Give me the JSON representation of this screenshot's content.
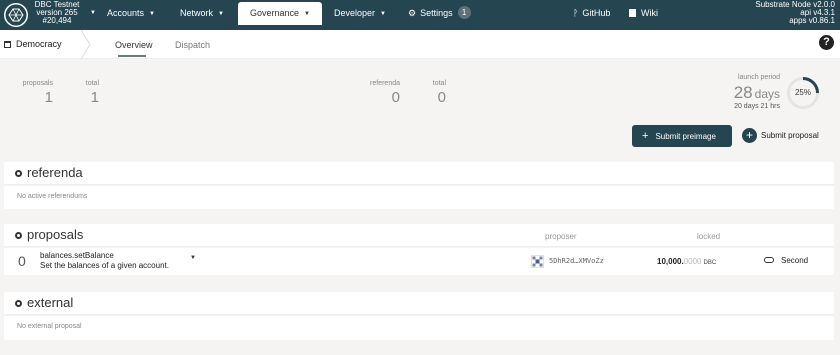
{
  "chain": {
    "name": "DBC Testnet",
    "version": "version 265",
    "block": "#20,494"
  },
  "nav": {
    "accounts": "Accounts",
    "network": "Network",
    "governance": "Governance",
    "developer": "Developer",
    "settings": "Settings",
    "settings_badge": "1",
    "github": "GitHub",
    "wiki": "Wiki"
  },
  "node": {
    "name": "Substrate Node v2.0.0",
    "api": "api v4.3.1",
    "apps": "apps v0.86.1"
  },
  "subnav": {
    "section": "Democracy",
    "tabs": [
      "Overview",
      "Dispatch"
    ]
  },
  "summary": {
    "proposals_label": "proposals",
    "proposals_value": "1",
    "proposals_total_label": "total",
    "proposals_total_value": "1",
    "referenda_label": "referenda",
    "referenda_value": "0",
    "referenda_total_label": "total",
    "referenda_total_value": "0",
    "launch_label": "launch period",
    "launch_days": "28",
    "launch_days_unit": "days",
    "launch_remaining": "20 days 21 hrs",
    "launch_percent": "25%",
    "launch_progress": 0.25
  },
  "actions": {
    "submit_preimage": "Submit preimage",
    "submit_proposal": "Submit proposal"
  },
  "referenda": {
    "title": "referenda",
    "empty": "No active referendums"
  },
  "proposals": {
    "title": "proposals",
    "col_proposer": "proposer",
    "col_locked": "locked",
    "rows": [
      {
        "index": "0",
        "call": "balances.setBalance",
        "description": "Set the balances of a given account.",
        "proposer": "5DhR2d…XMVoZz",
        "locked_int": "10,000.",
        "locked_dec": "0000",
        "unit": "DBC",
        "second_label": "Second"
      }
    ]
  },
  "external": {
    "title": "external",
    "empty": "No external proposal"
  },
  "colors": {
    "nav_bg": "#254551",
    "page_bg": "#f5f4f3",
    "accent": "#254551"
  }
}
